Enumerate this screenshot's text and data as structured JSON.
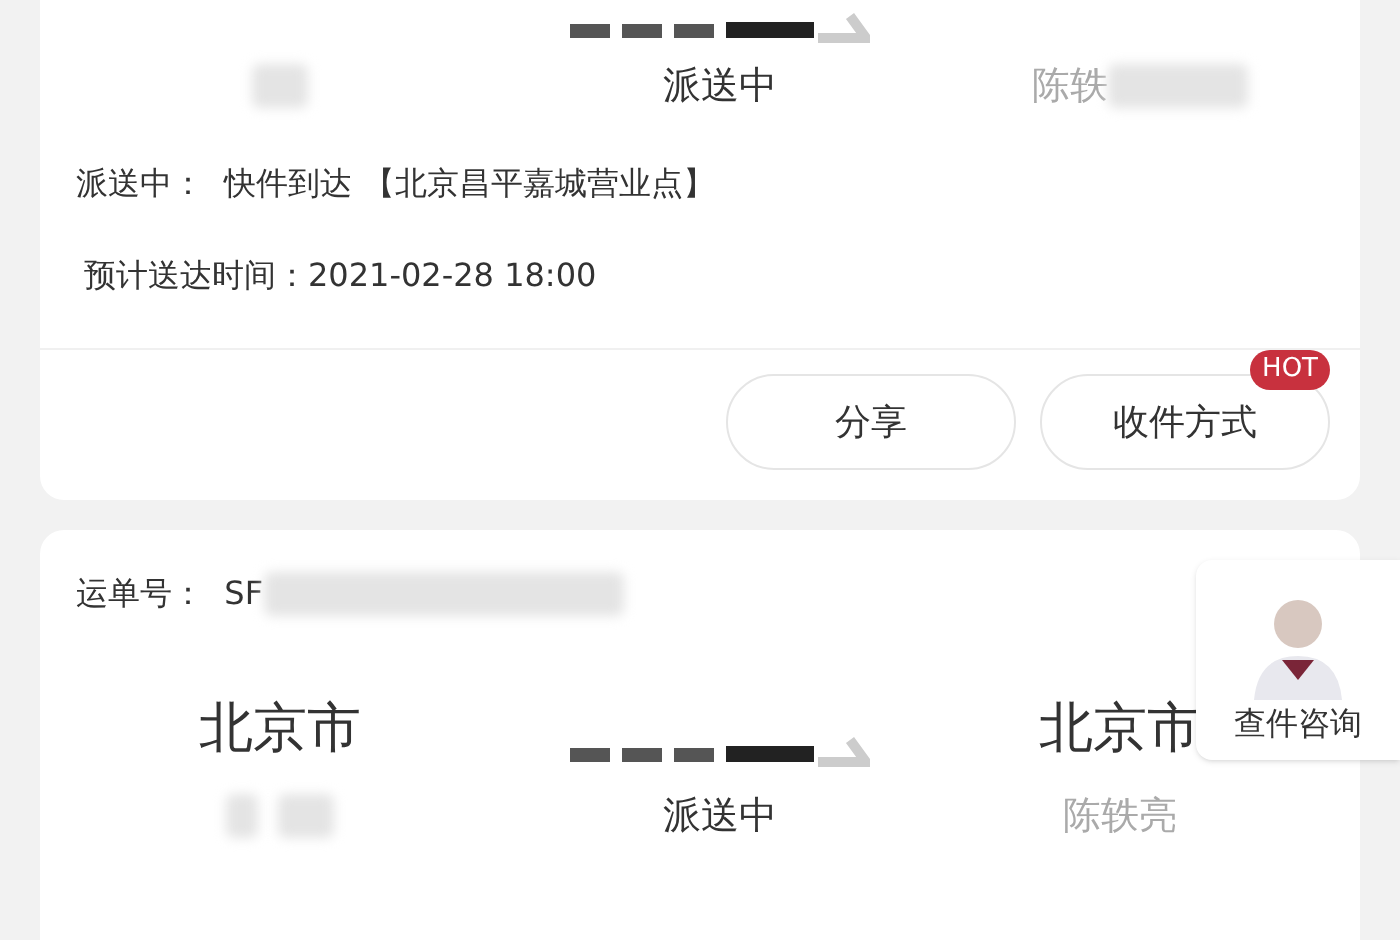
{
  "cards": [
    {
      "status": "派送中",
      "receiver": "陈轶",
      "event": "派送中：  快件到达 【北京昌平嘉城营业点】",
      "eta": "预计送达时间：2021-02-28 18:00",
      "buttons": [
        {
          "label": "分享"
        },
        {
          "label": "收件方式",
          "badge": "HOT"
        }
      ]
    },
    {
      "waybill": "运单号：  SF",
      "origin": "北京市",
      "destination": "北京市",
      "status": "派送中",
      "receiver": "陈轶亮"
    }
  ],
  "consult": {
    "label": "查件咨询"
  }
}
